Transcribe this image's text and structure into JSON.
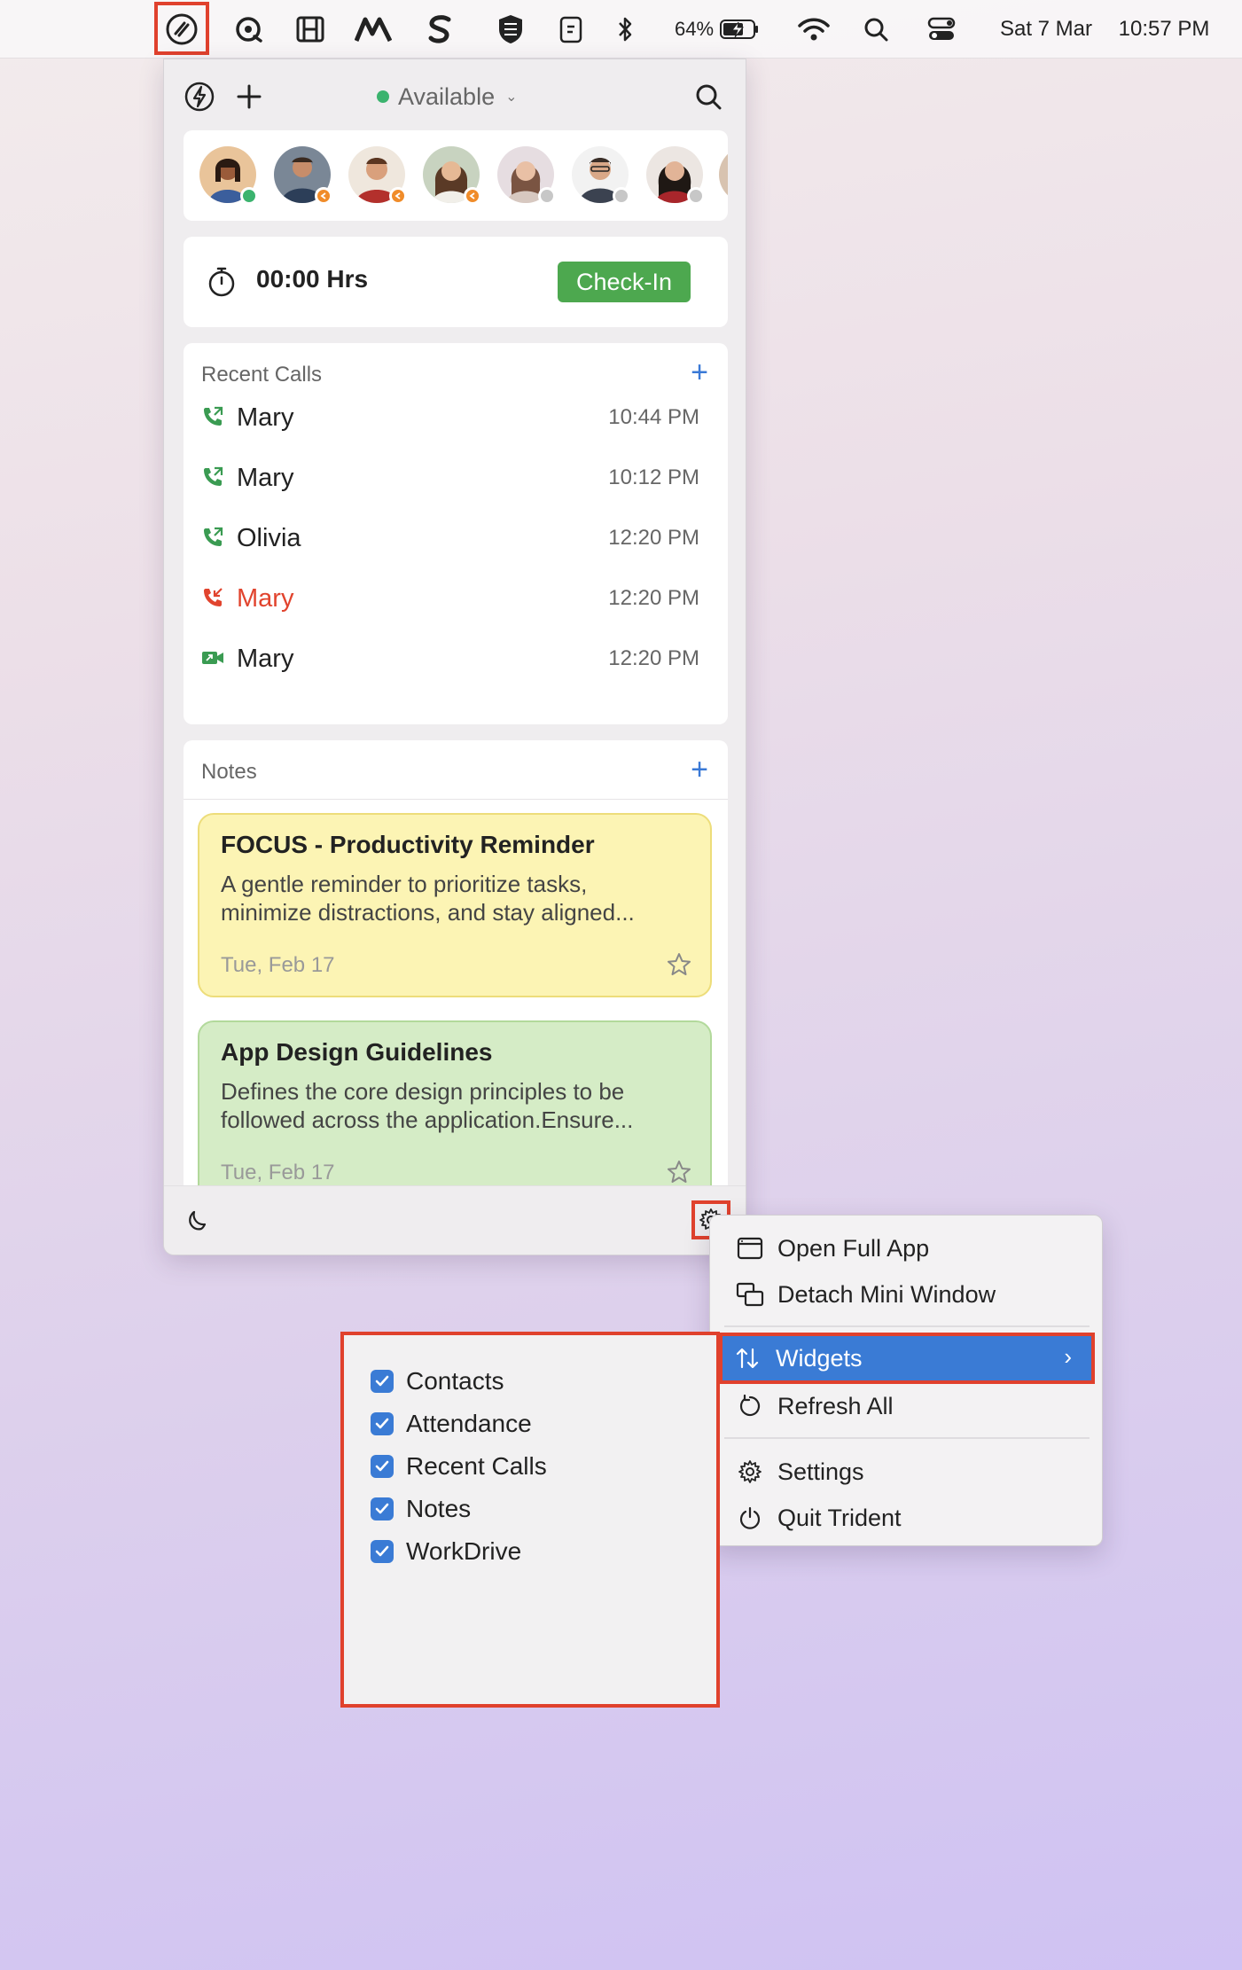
{
  "menubar": {
    "battery_percent": "64%",
    "date": "Sat 7 Mar",
    "time": "10:57 PM",
    "icons": [
      "trident-app-icon",
      "zoho-icon",
      "film-icon",
      "mountain-logo-icon",
      "s-logo-icon",
      "shield-icon",
      "clipboard-icon",
      "bluetooth-icon",
      "battery-icon",
      "wifi-icon",
      "spotlight-search-icon",
      "control-center-icon"
    ]
  },
  "panel": {
    "status_label": "Available",
    "attendance": {
      "timer": "00:00 Hrs",
      "checkin_label": "Check-In"
    },
    "recent_calls": {
      "title": "Recent Calls",
      "items": [
        {
          "name": "Mary",
          "time": "10:44 PM",
          "type": "outgoing"
        },
        {
          "name": "Mary",
          "time": "10:12 PM",
          "type": "outgoing"
        },
        {
          "name": "Olivia",
          "time": "12:20 PM",
          "type": "outgoing"
        },
        {
          "name": "Mary",
          "time": "12:20 PM",
          "type": "missed"
        },
        {
          "name": "Mary",
          "time": "12:20 PM",
          "type": "video"
        }
      ]
    },
    "notes": {
      "title": "Notes",
      "items": [
        {
          "title": "FOCUS - Productivity Reminder",
          "body_line1": "A gentle reminder to prioritize tasks,",
          "body_line2": "minimize distractions, and stay aligned...",
          "date": "Tue, Feb 17",
          "color": "#fcf4b4"
        },
        {
          "title": "App Design Guidelines",
          "body_line1": "Defines the core design principles to be",
          "body_line2": "followed across the application.Ensure...",
          "date": "Tue, Feb 17",
          "color": "#d5ecc6"
        }
      ]
    },
    "contacts": [
      {
        "presence": "online"
      },
      {
        "presence": "away"
      },
      {
        "presence": "away"
      },
      {
        "presence": "away"
      },
      {
        "presence": "offline"
      },
      {
        "presence": "offline"
      },
      {
        "presence": "offline"
      }
    ]
  },
  "context_menu": {
    "open_full_app": "Open Full App",
    "detach_mini_window": "Detach Mini Window",
    "widgets": "Widgets",
    "refresh_all": "Refresh All",
    "settings": "Settings",
    "quit": "Quit Trident"
  },
  "widgets_submenu": {
    "items": [
      {
        "label": "Contacts",
        "checked": true
      },
      {
        "label": "Attendance",
        "checked": true
      },
      {
        "label": "Recent Calls",
        "checked": true
      },
      {
        "label": "Notes",
        "checked": true
      },
      {
        "label": "WorkDrive",
        "checked": true
      }
    ]
  },
  "colors": {
    "accent_blue": "#3a7bd5",
    "checkin_green": "#4da84f",
    "missed_red": "#e1442e",
    "highlight_red": "#e0412d",
    "online_green": "#3bb36e"
  }
}
